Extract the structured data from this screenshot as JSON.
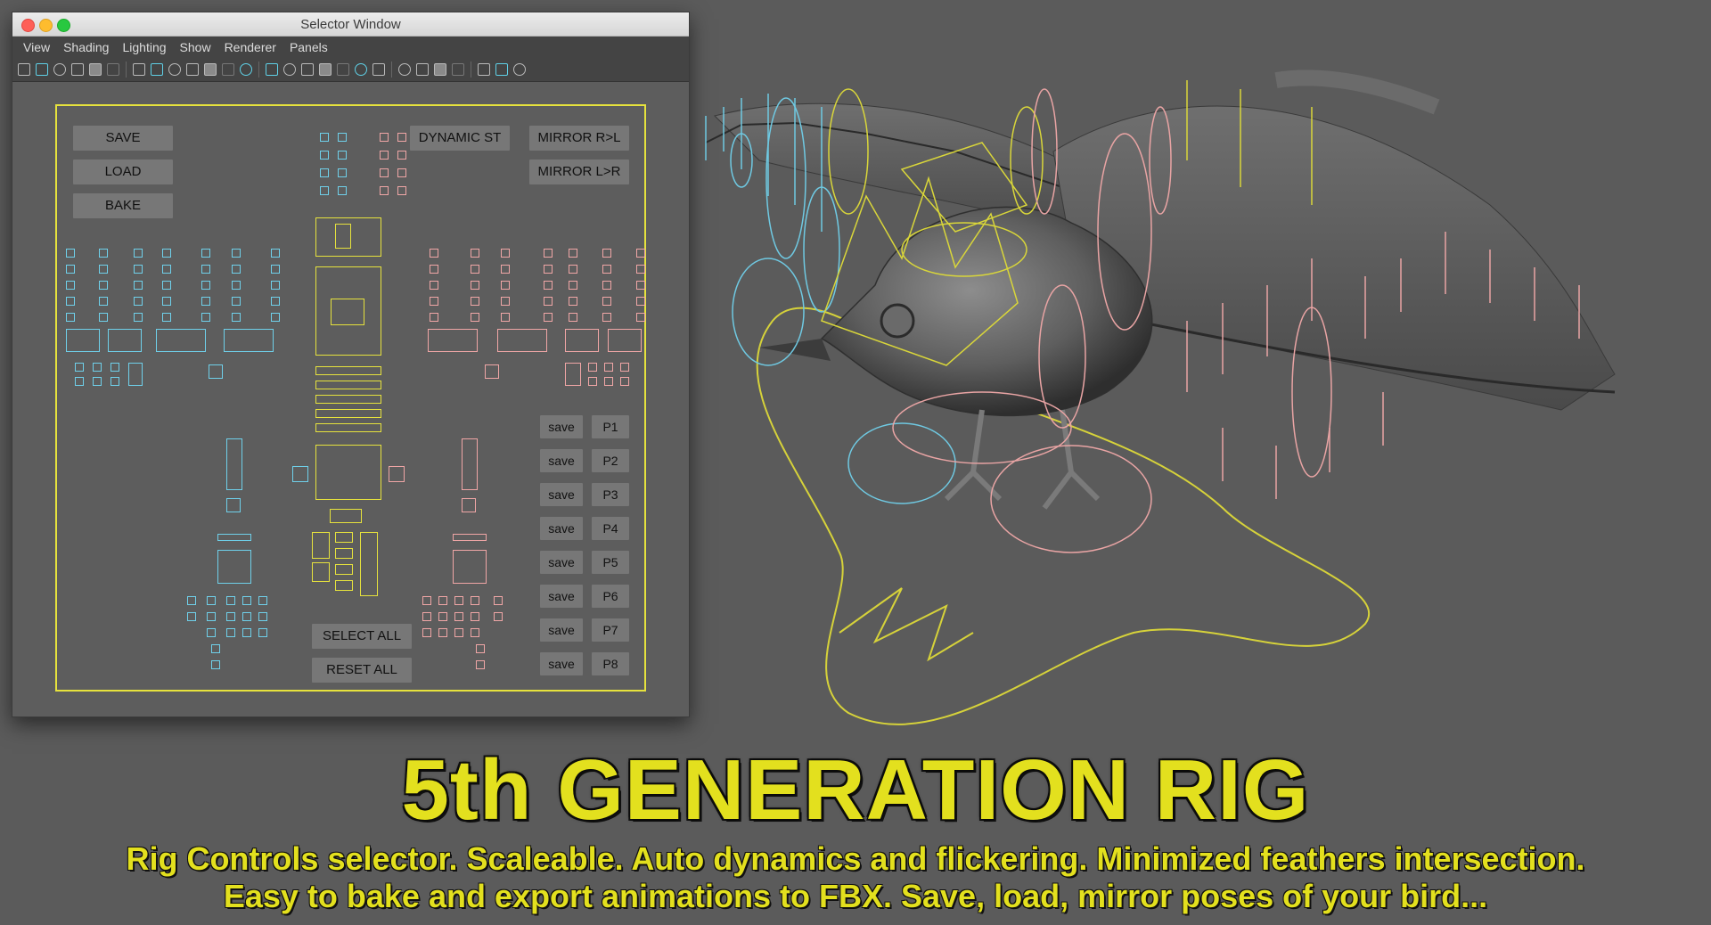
{
  "window": {
    "title": "Selector Window",
    "menu": [
      "View",
      "Shading",
      "Lighting",
      "Show",
      "Renderer",
      "Panels"
    ],
    "toolbar_icons": [
      "camera-icon",
      "camera-attr-icon",
      "bookmark-icon",
      "image-plane-icon",
      "move-camera-icon",
      "pencil-icon",
      "sep",
      "grid-icon",
      "film-gate-icon",
      "resolution-gate-icon",
      "gate-mask-icon",
      "field-chart-icon",
      "safe-action-icon",
      "safe-title-icon",
      "sep",
      "wireframe-icon",
      "smooth-shade-icon",
      "default-material-icon",
      "wireframe-on-shaded-icon",
      "xray-icon",
      "use-all-lights-icon",
      "shadows-icon",
      "sep",
      "ambient-occlusion-icon",
      "motion-blur-icon",
      "anti-alias-icon",
      "depth-of-field-icon",
      "sep",
      "isolate-select-icon",
      "xray-joints-icon",
      "xray-active-icon"
    ]
  },
  "picker": {
    "save": "SAVE",
    "load": "LOAD",
    "bake": "BAKE",
    "dynamic_st": "DYNAMIC ST",
    "mirror_rl": "MIRROR R>L",
    "mirror_lr": "MIRROR L>R",
    "select_all": "SELECT ALL",
    "reset_all": "RESET ALL",
    "pose_save_label": "save",
    "poses": [
      "P1",
      "P2",
      "P3",
      "P4",
      "P5",
      "P6",
      "P7",
      "P8"
    ]
  },
  "colors": {
    "left_side": "#6fd0ea",
    "right_side": "#f0a6a6",
    "center": "#e6e23d",
    "headline": "#e3e01e"
  },
  "headline": "5th GENERATION RIG",
  "subline1": "Rig Controls selector. Scaleable. Auto dynamics and flickering. Minimized feathers intersection.",
  "subline2": "Easy to bake and export animations to FBX. Save, load, mirror poses of your bird..."
}
